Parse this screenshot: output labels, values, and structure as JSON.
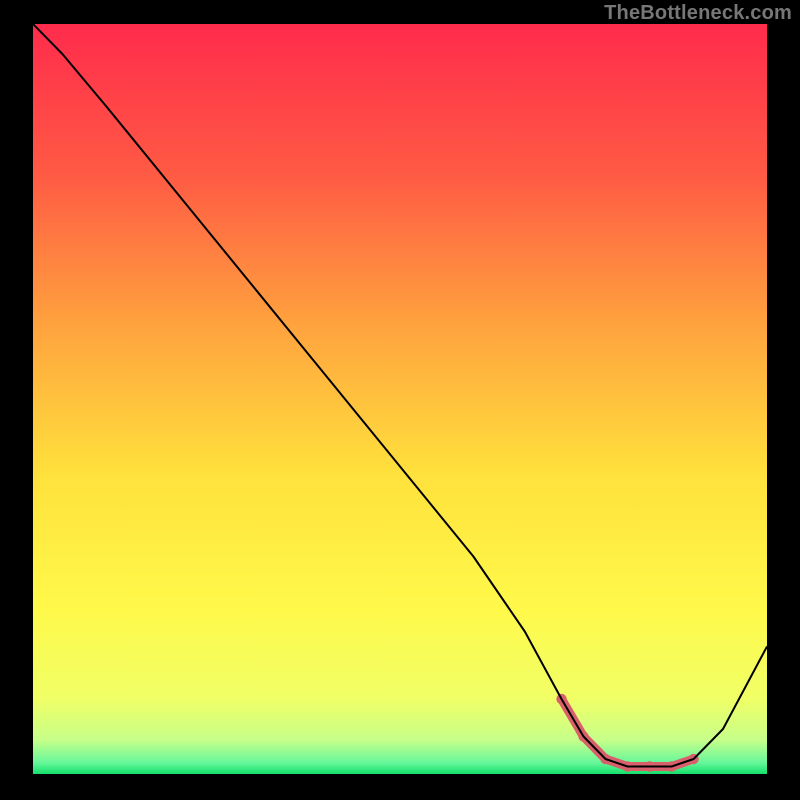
{
  "watermark": "TheBottleneck.com",
  "chart_data": {
    "type": "line",
    "title": "",
    "xlabel": "",
    "ylabel": "",
    "xlim": [
      0,
      100
    ],
    "ylim": [
      0,
      100
    ],
    "background_gradient": {
      "stops": [
        {
          "offset": 0.0,
          "color": "#ff2b4c"
        },
        {
          "offset": 0.2,
          "color": "#ff5a44"
        },
        {
          "offset": 0.4,
          "color": "#ffa23e"
        },
        {
          "offset": 0.6,
          "color": "#ffe13c"
        },
        {
          "offset": 0.78,
          "color": "#fff94a"
        },
        {
          "offset": 0.9,
          "color": "#f0ff66"
        },
        {
          "offset": 0.955,
          "color": "#c6ff8a"
        },
        {
          "offset": 0.985,
          "color": "#66f79a"
        },
        {
          "offset": 1.0,
          "color": "#13e06a"
        }
      ]
    },
    "series": [
      {
        "name": "bottleneck-curve",
        "color": "#000000",
        "stroke_width": 2,
        "x": [
          0,
          4,
          10,
          20,
          30,
          40,
          50,
          60,
          67,
          72,
          75,
          78,
          81,
          84,
          87,
          90,
          94,
          100
        ],
        "y": [
          100,
          96,
          89,
          77,
          65,
          53,
          41,
          29,
          19,
          10,
          5,
          2,
          1,
          1,
          1,
          2,
          6,
          17
        ]
      }
    ],
    "highlight": {
      "name": "optimal-range",
      "color": "#d9606b",
      "stroke_width": 9,
      "x": [
        72,
        75,
        78,
        81,
        84,
        87,
        90
      ],
      "y": [
        10,
        5,
        2,
        1,
        1,
        1,
        2
      ]
    }
  }
}
